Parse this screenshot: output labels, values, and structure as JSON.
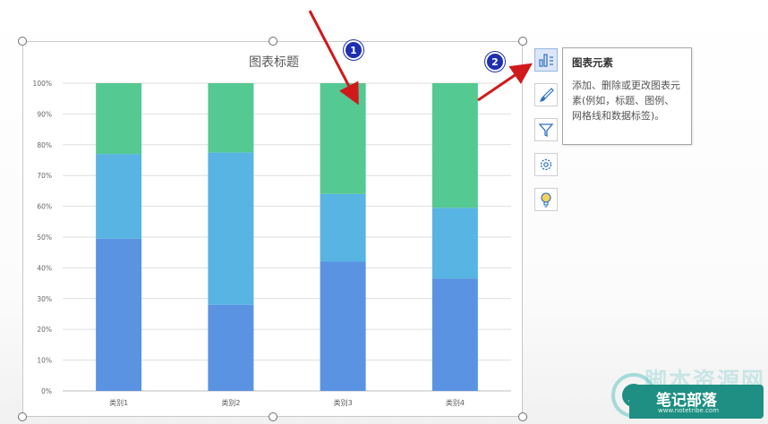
{
  "chart_data": {
    "type": "bar",
    "stacked": "percent",
    "title": "图表标题",
    "categories": [
      "类别1",
      "类别2",
      "类别3",
      "类别4"
    ],
    "series": [
      {
        "values": [
          49.5,
          28,
          42,
          36.5
        ],
        "color": "#5b93e3"
      },
      {
        "values": [
          27.5,
          49.5,
          22,
          23
        ],
        "color": "#58b4e3"
      },
      {
        "values": [
          23,
          22.5,
          36,
          40.5
        ],
        "color": "#55c992"
      }
    ],
    "ylim": [
      0,
      100
    ],
    "yticks": [
      "0%",
      "10%",
      "20%",
      "30%",
      "40%",
      "50%",
      "60%",
      "70%",
      "80%",
      "90%",
      "100%"
    ],
    "grid": true
  },
  "side_buttons": [
    {
      "name": "chart-elements-button",
      "icon": "chart-elements-icon",
      "active": true
    },
    {
      "name": "chart-styles-button",
      "icon": "brush-icon",
      "active": false
    },
    {
      "name": "chart-filters-button",
      "icon": "filter-icon",
      "active": false
    },
    {
      "name": "chart-settings-button",
      "icon": "gear-icon",
      "active": false
    },
    {
      "name": "chart-ideas-button",
      "icon": "lightbulb-icon",
      "active": false
    }
  ],
  "tooltip": {
    "title": "图表元素",
    "body": "添加、删除或更改图表元素(例如，标题、图例、网格线和数据标签)。"
  },
  "badges": {
    "one": "1",
    "two": "2"
  },
  "annotation_color": "#d0191b",
  "watermark": {
    "big_text": "脚本资源网",
    "title": "笔记部落",
    "url": "www.notetribe.com"
  }
}
